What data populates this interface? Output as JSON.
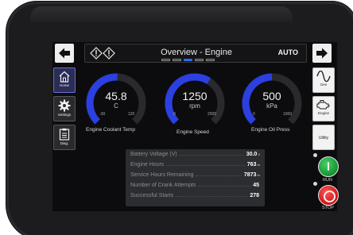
{
  "header": {
    "title": "Overview - Engine",
    "mode": "AUTO",
    "page_count": 5,
    "active_page": 3
  },
  "left_nav": [
    {
      "label": "Home",
      "icon": "home-icon",
      "active": true
    },
    {
      "label": "Settings",
      "icon": "gear-icon",
      "active": false
    },
    {
      "label": "Diag.",
      "icon": "clipboard-icon",
      "active": false
    }
  ],
  "right_nav": [
    {
      "label": "Gen",
      "icon": "sine-wave-icon"
    },
    {
      "label": "Engine",
      "icon": "engine-icon"
    },
    {
      "label": "Utility",
      "icon": "utility-icon"
    }
  ],
  "gauges": [
    {
      "label": "Engine Coolant Temp",
      "value": "45.8",
      "unit": "C",
      "min": "-30",
      "max": "120",
      "fraction": 0.51
    },
    {
      "label": "Engine Speed",
      "value": "1250",
      "unit": "rpm",
      "min": "0",
      "max": "2000",
      "fraction": 0.62
    },
    {
      "label": "Engine Oil Press",
      "value": "500",
      "unit": "kPa",
      "min": "0",
      "max": "1000",
      "fraction": 0.5
    }
  ],
  "info": [
    {
      "label": "Battery Voltage (V)",
      "value": "30.0",
      "unit": "V"
    },
    {
      "label": "Engine Hours",
      "value": "763",
      "unit": "hr"
    },
    {
      "label": "Service Hours Remaining",
      "value": "7873",
      "unit": "hr"
    },
    {
      "label": "Number of Crank Attempts",
      "value": "45",
      "unit": ""
    },
    {
      "label": "Successful Starts",
      "value": "278",
      "unit": ""
    }
  ],
  "controls": {
    "run_label": "RUN",
    "stop_label": "STOP"
  },
  "colors": {
    "gauge_fill": "#2c3fe0",
    "gauge_track": "#2a2a2e",
    "run": "#1ea83a",
    "stop": "#e01c1c",
    "page_active": "#2c6df0"
  }
}
